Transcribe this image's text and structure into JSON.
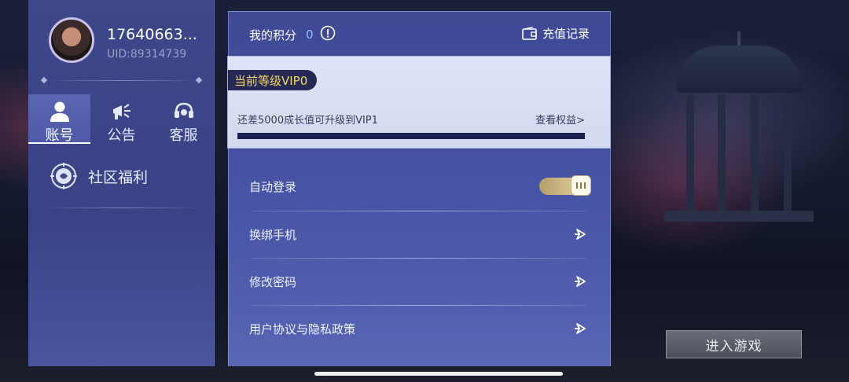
{
  "user": {
    "name": "17640663...",
    "uid": "UID:89314739"
  },
  "nav": {
    "tabs": [
      {
        "label": "账号",
        "icon": "person-icon",
        "active": true
      },
      {
        "label": "公告",
        "icon": "megaphone-icon",
        "active": false
      },
      {
        "label": "客服",
        "icon": "headset-icon",
        "active": false
      }
    ],
    "community": {
      "label": "社区福利",
      "icon": "dragon-emblem-icon"
    }
  },
  "points": {
    "label": "我的积分",
    "value": "0",
    "recharge_label": "充值记录"
  },
  "vip": {
    "badge": "当前等级VIP0",
    "hint": "还差5000成长值可升级到VIP1",
    "link": "查看权益>",
    "progress": 1.0
  },
  "settings": [
    {
      "label": "自动登录",
      "control": "toggle",
      "on": true
    },
    {
      "label": "换绑手机",
      "control": "arrow"
    },
    {
      "label": "修改密码",
      "control": "arrow"
    },
    {
      "label": "用户协议与隐私政策",
      "control": "arrow"
    }
  ],
  "start_button": {
    "label": "进入游戏"
  },
  "colors": {
    "accent_gold": "#e6d8a8",
    "vip_badge_text": "#f2d46a",
    "points_value": "#8ec2ff",
    "panel": "#4855a6"
  }
}
